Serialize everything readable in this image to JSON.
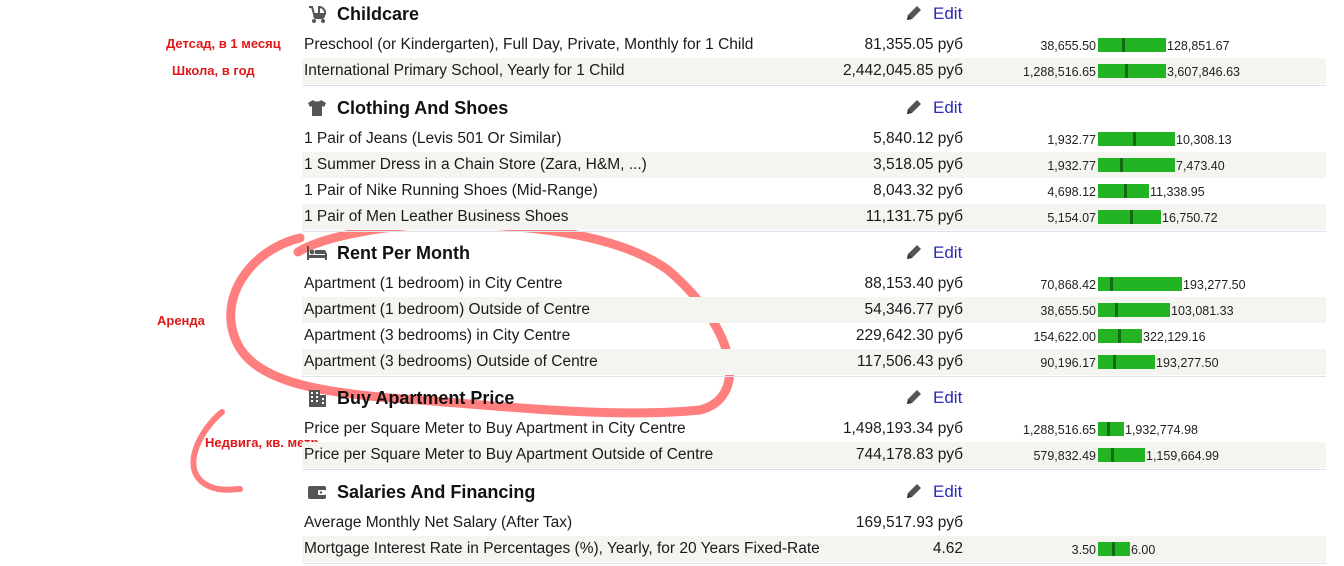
{
  "annotations": {
    "kindergarten": "Детсад, в 1 месяц",
    "school": "Школа, в год",
    "rent": "Аренда",
    "realestate": "Недвига, кв. метр"
  },
  "accent_color": "#2b2bb5",
  "bar_color": "#22b422",
  "categories": [
    {
      "title": "Childcare",
      "icon": "stroller-icon",
      "edit": "Edit",
      "rows": [
        {
          "name": "Preschool (or Kindergarten), Full Day, Private, Monthly for 1 Child",
          "price": "81,355.05 руб",
          "low": "38,655.50",
          "high": "128,851.67",
          "position": 0.35
        },
        {
          "name": "International Primary School, Yearly for 1 Child",
          "price": "2,442,045.85 руб",
          "low": "1,288,516.65",
          "high": "3,607,846.63",
          "position": 0.4
        }
      ]
    },
    {
      "title": "Clothing And Shoes",
      "icon": "tshirt-icon",
      "edit": "Edit",
      "rows": [
        {
          "name": "1 Pair of Jeans (Levis 501 Or Similar)",
          "price": "5,840.12 руб",
          "low": "1,932.77",
          "high": "10,308.13",
          "position": 0.45
        },
        {
          "name": "1 Summer Dress in a Chain Store (Zara, H&M, ...)",
          "price": "3,518.05 руб",
          "low": "1,932.77",
          "high": "7,473.40",
          "position": 0.29
        },
        {
          "name": "1 Pair of Nike Running Shoes (Mid-Range)",
          "price": "8,043.32 руб",
          "low": "4,698.12",
          "high": "11,338.95",
          "position": 0.5
        },
        {
          "name": "1 Pair of Men Leather Business Shoes",
          "price": "11,131.75 руб",
          "low": "5,154.07",
          "high": "16,750.72",
          "position": 0.5
        }
      ]
    },
    {
      "title": "Rent Per Month",
      "icon": "bed-icon",
      "edit": "Edit",
      "rows": [
        {
          "name": "Apartment (1 bedroom) in City Centre",
          "price": "88,153.40 руб",
          "low": "70,868.42",
          "high": "193,277.50",
          "position": 0.14
        },
        {
          "name": "Apartment (1 bedroom) Outside of Centre",
          "price": "54,346.77 руб",
          "low": "38,655.50",
          "high": "103,081.33",
          "position": 0.24
        },
        {
          "name": "Apartment (3 bedrooms) in City Centre",
          "price": "229,642.30 руб",
          "low": "154,622.00",
          "high": "322,129.16",
          "position": 0.45
        },
        {
          "name": "Apartment (3 bedrooms) Outside of Centre",
          "price": "117,506.43 руб",
          "low": "90,196.17",
          "high": "193,277.50",
          "position": 0.26
        }
      ]
    },
    {
      "title": "Buy Apartment Price",
      "icon": "building-icon",
      "edit": "Edit",
      "rows": [
        {
          "name": "Price per Square Meter to Buy Apartment in City Centre",
          "price": "1,498,193.34 руб",
          "low": "1,288,516.65",
          "high": "1,932,774.98",
          "position": 0.33
        },
        {
          "name": "Price per Square Meter to Buy Apartment Outside of Centre",
          "price": "744,178.83 руб",
          "low": "579,832.49",
          "high": "1,159,664.99",
          "position": 0.28
        }
      ]
    },
    {
      "title": "Salaries And Financing",
      "icon": "wallet-icon",
      "edit": "Edit",
      "rows": [
        {
          "name": "Average Monthly Net Salary (After Tax)",
          "price": "169,517.93 руб",
          "low": "",
          "high": "",
          "position": null
        },
        {
          "name": "Mortgage Interest Rate in Percentages (%), Yearly, for 20 Years Fixed-Rate",
          "price": "4.62",
          "low": "3.50",
          "high": "6.00",
          "position": 0.45
        }
      ]
    }
  ]
}
